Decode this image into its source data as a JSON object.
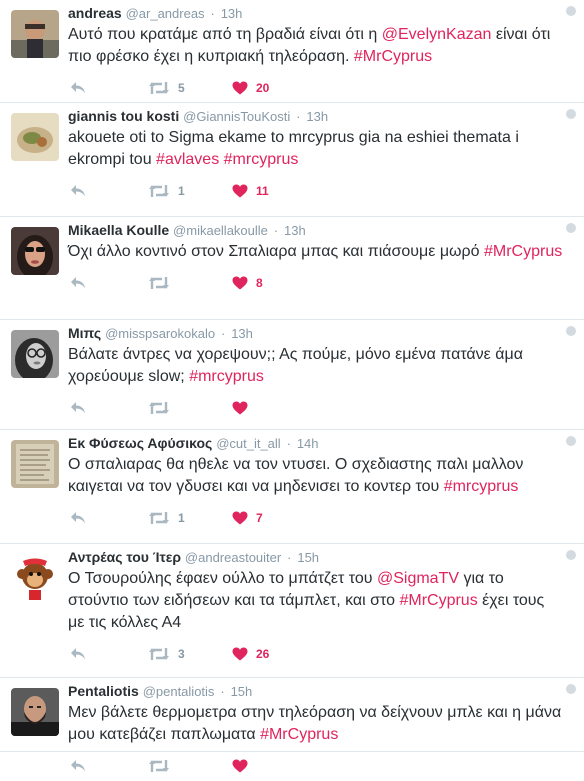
{
  "tweets": [
    {
      "fullname": "andreas",
      "username": "@ar_andreas",
      "time": "13h",
      "text_parts": [
        {
          "t": "Αυτό που κρατάμε από τη βραδιά είναι ότι η "
        },
        {
          "t": "@EvelynKazan",
          "tag": true
        },
        {
          "t": " είναι ότι πιο φρέσκο έχει η κυπριακή τηλεόραση. "
        },
        {
          "t": "#MrCyprus",
          "tag": true
        }
      ],
      "retweets": "5",
      "likes": "20",
      "avatar": "selfie-man-avatar"
    },
    {
      "fullname": "giannis tou kosti",
      "username": "@GiannisTouKosti",
      "time": "13h",
      "text_parts": [
        {
          "t": "akouete oti to Sigma ekame to mrcyprus gia na eshiei themata i ekrompi tou "
        },
        {
          "t": "#avlaves",
          "tag": true
        },
        {
          "t": "  "
        },
        {
          "t": "#mrcyprus",
          "tag": true
        }
      ],
      "retweets": "1",
      "likes": "11",
      "avatar": "food-avatar"
    },
    {
      "fullname": "Mikaella Koulle",
      "username": "@mikaellakoulle",
      "time": "13h",
      "text_parts": [
        {
          "t": "Όχι άλλο κοντινό στον Σπαλιαρα μπας και πιάσουμε μωρό  "
        },
        {
          "t": "#MrCyprus",
          "tag": true
        }
      ],
      "retweets": "",
      "likes": "8",
      "avatar": "woman-sunglasses-avatar"
    },
    {
      "fullname": "Μιπς",
      "username": "@misspsarokokalo",
      "time": "13h",
      "text_parts": [
        {
          "t": "Βάλατε άντρες να χορεψουν;; Ας πούμε, μόνο εμένα πατάνε άμα χορεύουμε slow; "
        },
        {
          "t": "#mrcyprus",
          "tag": true
        }
      ],
      "retweets": "",
      "likes": "",
      "avatar": "woman-glasses-avatar"
    },
    {
      "fullname": "Εκ Φύσεως Αφύσικος",
      "username": "@cut_it_all",
      "time": "14h",
      "text_parts": [
        {
          "t": "Ο σπαλιαρας θα ηθελε να τον ντυσει. Ο σχεδιαστης παλι μαλλον καιγεται να τον γδυσει και να μηδενισει το κοντερ του "
        },
        {
          "t": "#mrcyprus",
          "tag": true
        }
      ],
      "retweets": "1",
      "likes": "7",
      "avatar": "old-paper-avatar"
    },
    {
      "fullname": "Αντρέας του Ίτερ",
      "username": "@andreastouiter",
      "time": "15h",
      "text_parts": [
        {
          "t": "Ο Τσουρούλης έφαεν ούλλο το μπάτζετ του "
        },
        {
          "t": "@SigmaTV",
          "tag": true
        },
        {
          "t": " για το στούντιο των ειδήσεων και τα τάμπλετ, και στο "
        },
        {
          "t": "#MrCyprus",
          "tag": true
        },
        {
          "t": " έχει τους με τις κόλλες Α4"
        }
      ],
      "retweets": "3",
      "likes": "26",
      "avatar": "monkey-cartoon-avatar"
    },
    {
      "fullname": "Pentaliotis",
      "username": "@pentaliotis",
      "time": "15h",
      "text_parts": [
        {
          "t": "Μεν βάλετε  θερμομετρα στην τηλεόραση να δείχνουν μπλε και η μάνα μου κατεβάζει  παπλωματα "
        },
        {
          "t": "#MrCyprus",
          "tag": true
        }
      ],
      "retweets": "",
      "likes": "",
      "avatar": "bearded-man-avatar"
    }
  ],
  "colors": {
    "accent": "#e0245e",
    "muted": "#8899a6",
    "border": "#e1e8ed",
    "text": "#292f33"
  }
}
